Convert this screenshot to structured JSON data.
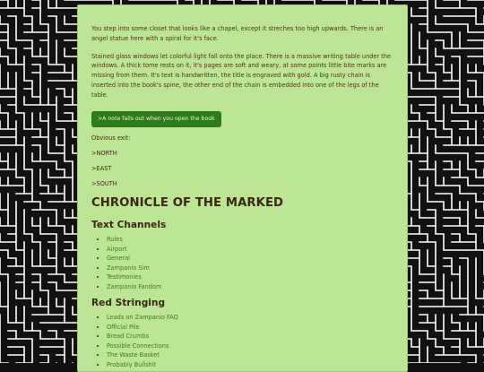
{
  "room": {
    "intro": "You step into some closet that looks like a chapel, except it streches too high upwards. There is an angel statue here with a spiral for it's face.",
    "description": "Stained glass windows let colorful light fall onto the place. There is a massive writing table under the windows. A thick tome rests on it, it's pages are soft and weary, at some points little bite marks are missing from them. It's text is handwritten, the title is engraved with gold. A big rusty chain is inserted into the book's spine, the other end of the chain is embedded into one of the legs of the table.",
    "action_button": ">A note falls out when you open the book",
    "exits_label": "Obvious exit:",
    "exits": [
      ">NORTH",
      ">EAST",
      ">SOUTH"
    ]
  },
  "page_title": "CHRONICLE OF THE MARKED",
  "sections": {
    "text_channels": {
      "title": "Text Channels",
      "items": [
        "Rules",
        "Airport",
        "General",
        "Zampanio Sim",
        "Testimonies",
        "Zampanio Fandom"
      ]
    },
    "red_stringing": {
      "title": "Red Stringing",
      "items": [
        "Leads on Zampanio FAQ",
        "Official Pile",
        "Bread Crumbs",
        "Possible Connections",
        "The Waste Basket",
        "Probably Bullshit"
      ]
    }
  },
  "colors": {
    "panel_bg": "#bde596",
    "button_bg": "#2f7a1b",
    "link": "#3d7a1e",
    "text": "#3a2712",
    "maze_bg": "#111111",
    "maze_line": "#ffffff"
  }
}
